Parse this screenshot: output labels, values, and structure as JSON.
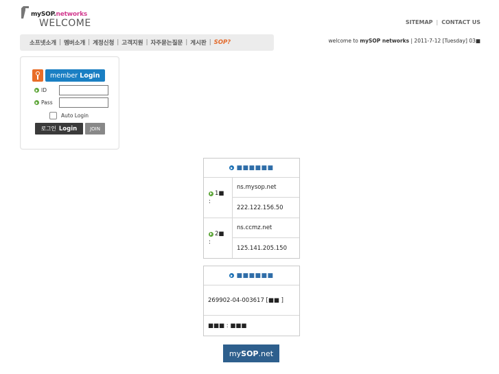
{
  "header": {
    "logo_prefix": "mySOP.",
    "logo_suffix": "networks",
    "logo_sub": "WELCOME",
    "links": [
      "SITEMAP",
      "CONTACT US"
    ],
    "link_sep": "|"
  },
  "nav": {
    "items": [
      "소프넷소개",
      "멤버소개",
      "계정신청",
      "고객지원",
      "자주묻는질문",
      "게시판"
    ],
    "special": "SOP?",
    "sep": "|"
  },
  "welcome": {
    "prefix": "welcome to ",
    "brand": "mySOP networks",
    "rest": " | 2011-7-12 [Tuesday] 03■"
  },
  "login": {
    "title_prefix": "member",
    "title_strong": "Login",
    "id_label": "ID",
    "pass_label": "Pass",
    "id_value": "",
    "pass_value": "",
    "auto_login": "Auto Login",
    "login_btn_kr": "로그인",
    "login_btn_en": "Login",
    "join_btn": "JOIN"
  },
  "ns_table": {
    "title": "■■■■■■",
    "rows": [
      {
        "label": "1■",
        "label_extra": ":",
        "name": "ns.mysop.net",
        "ip": "222.122.156.50"
      },
      {
        "label": "2■",
        "label_extra": ":",
        "name": "ns.ccmz.net",
        "ip": "125.141.205.150"
      }
    ]
  },
  "biz_table": {
    "title": "■■■■■■",
    "reg_no": "269902-04-003617 [■■ ]",
    "owner": "■■■ : ■■■"
  },
  "footer": {
    "prefix": "my",
    "strong": "SOP",
    "suffix": ".net"
  },
  "colors": {
    "accent_blue": "#1a7fc3",
    "accent_orange": "#e86d28",
    "accent_pink": "#d23a8f",
    "accent_green": "#5ea63a",
    "footer_bg": "#2e5f8d"
  }
}
